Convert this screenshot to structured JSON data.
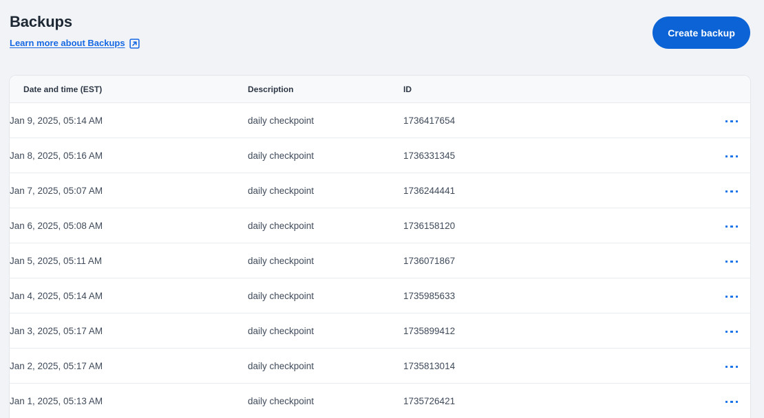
{
  "header": {
    "title": "Backups",
    "learn_more_label": "Learn more about Backups",
    "learn_more_icon": "external-link-icon",
    "create_button_label": "Create backup"
  },
  "colors": {
    "accent_blue": "#0c63d6",
    "link_blue": "#1668e3",
    "dots_blue": "#1a73e8",
    "page_bg": "#f1f3f6",
    "table_header_bg": "#f8f9fb",
    "row_border": "#e7eaee",
    "title_text": "#1d2733",
    "cell_text": "#3f4a5a"
  },
  "table": {
    "columns": [
      {
        "key": "date",
        "label": "Date and time (EST)"
      },
      {
        "key": "description",
        "label": "Description"
      },
      {
        "key": "id",
        "label": "ID"
      },
      {
        "key": "menu",
        "label": ""
      }
    ],
    "row_menu_icon": "more-options-icon",
    "rows": [
      {
        "date": "Jan 9, 2025, 05:14 AM",
        "description": "daily checkpoint",
        "id": "1736417654"
      },
      {
        "date": "Jan 8, 2025, 05:16 AM",
        "description": "daily checkpoint",
        "id": "1736331345"
      },
      {
        "date": "Jan 7, 2025, 05:07 AM",
        "description": "daily checkpoint",
        "id": "1736244441"
      },
      {
        "date": "Jan 6, 2025, 05:08 AM",
        "description": "daily checkpoint",
        "id": "1736158120"
      },
      {
        "date": "Jan 5, 2025, 05:11 AM",
        "description": "daily checkpoint",
        "id": "1736071867"
      },
      {
        "date": "Jan 4, 2025, 05:14 AM",
        "description": "daily checkpoint",
        "id": "1735985633"
      },
      {
        "date": "Jan 3, 2025, 05:17 AM",
        "description": "daily checkpoint",
        "id": "1735899412"
      },
      {
        "date": "Jan 2, 2025, 05:17 AM",
        "description": "daily checkpoint",
        "id": "1735813014"
      },
      {
        "date": "Jan 1, 2025, 05:13 AM",
        "description": "daily checkpoint",
        "id": "1735726421"
      }
    ]
  }
}
